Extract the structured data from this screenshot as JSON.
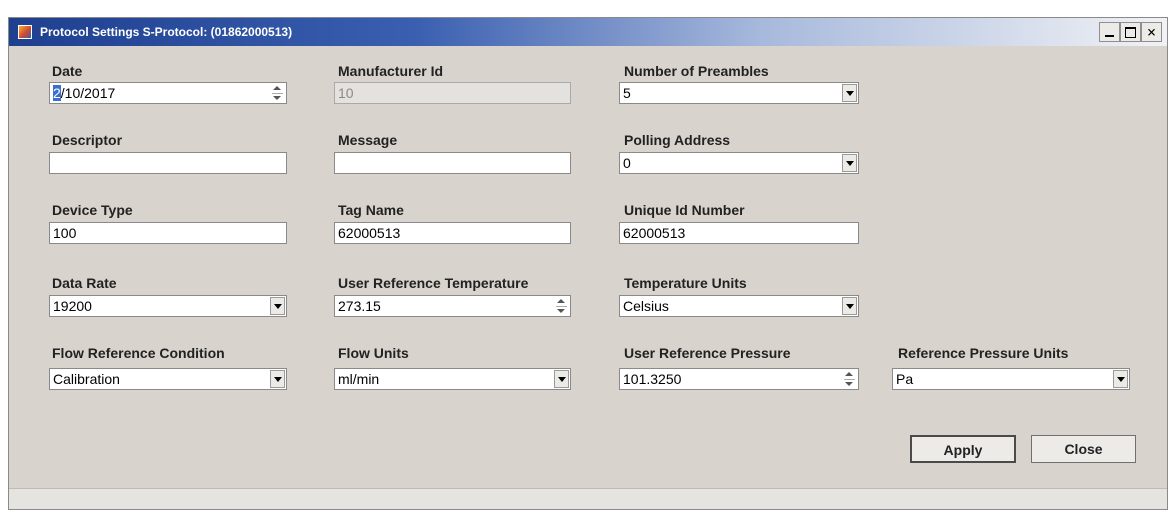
{
  "window": {
    "title": "Protocol Settings S-Protocol: (01862000513)",
    "controls": {
      "minimize": "_",
      "maximize": "□",
      "close": "×"
    }
  },
  "fields": {
    "date": {
      "label": "Date",
      "value_selected": "2",
      "value_rest": "/10/2017"
    },
    "manufacturer_id": {
      "label": "Manufacturer Id",
      "value": "10"
    },
    "number_of_preambles": {
      "label": "Number of Preambles",
      "value": "5"
    },
    "descriptor": {
      "label": "Descriptor",
      "value": ""
    },
    "message": {
      "label": "Message",
      "value": ""
    },
    "polling_address": {
      "label": "Polling Address",
      "value": "0"
    },
    "device_type": {
      "label": "Device Type",
      "value": "100"
    },
    "tag_name": {
      "label": "Tag Name",
      "value": "62000513"
    },
    "unique_id_number": {
      "label": "Unique Id Number",
      "value": "62000513"
    },
    "data_rate": {
      "label": "Data Rate",
      "value": "19200"
    },
    "user_reference_temperature": {
      "label": "User Reference Temperature",
      "value": "273.15"
    },
    "temperature_units": {
      "label": "Temperature Units",
      "value": "Celsius"
    },
    "flow_reference_condition": {
      "label": "Flow Reference Condition",
      "value": "Calibration"
    },
    "flow_units": {
      "label": "Flow Units",
      "value": "ml/min"
    },
    "user_reference_pressure": {
      "label": "User Reference Pressure",
      "value": "101.3250"
    },
    "reference_pressure_units": {
      "label": "Reference Pressure Units",
      "value": "Pa"
    }
  },
  "buttons": {
    "apply": "Apply",
    "close": "Close"
  },
  "colors": {
    "titlebar_start": "#1f3f8f",
    "window_bg": "#d8d4cd",
    "selection": "#3a6fcf"
  }
}
